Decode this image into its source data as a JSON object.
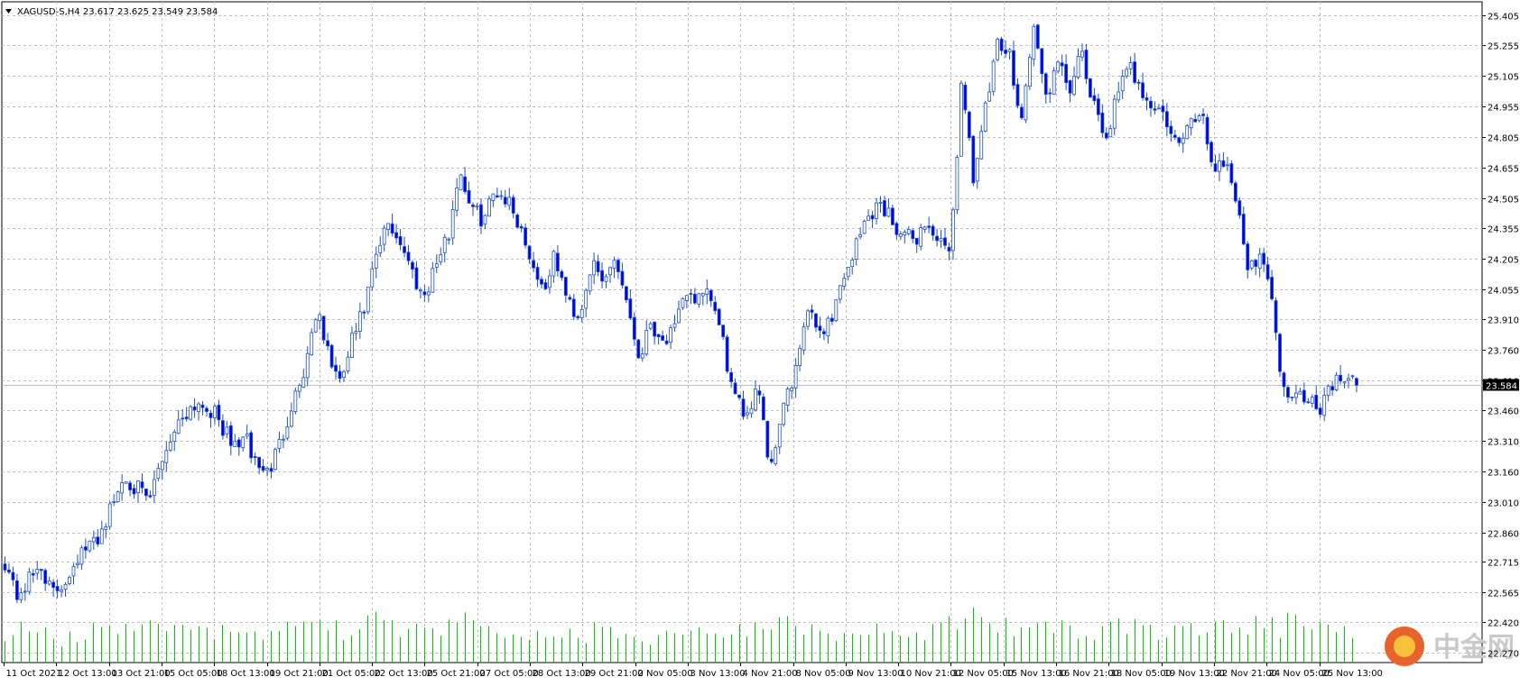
{
  "header": {
    "symbol_line": "XAGUSD-S,H4  23.617 23.625 23.549 23.584",
    "dropdown_icon": "triangle-down-icon"
  },
  "watermark": {
    "text": "中金网",
    "logo_icon": "cngold-logo-icon"
  },
  "colors": {
    "bull": "#ffffff",
    "bear": "#0000ee",
    "candle_outline": "#1e4fc8",
    "volume": "#00cc00",
    "grid": "#c0c0c0",
    "price_line": "#c0c0c0",
    "price_tag_bg": "#000000",
    "price_tag_text": "#ffffff"
  },
  "chart_data": {
    "type": "candlestick",
    "symbol": "XAGUSD-S",
    "timeframe": "H4",
    "last_price": 23.584,
    "current_price_label": "23.584",
    "ohlc_header": {
      "open": 23.617,
      "high": 23.625,
      "low": 23.549,
      "close": 23.584
    },
    "ylim": [
      22.22,
      25.47
    ],
    "y_ticks": [
      "25.405",
      "25.255",
      "25.105",
      "24.955",
      "24.805",
      "24.655",
      "24.505",
      "24.355",
      "24.205",
      "24.055",
      "23.910",
      "23.760",
      "23.610",
      "23.460",
      "23.310",
      "23.160",
      "23.010",
      "22.860",
      "22.715",
      "22.565",
      "22.420",
      "22.270"
    ],
    "x_ticks": [
      "11 Oct 2021",
      "12 Oct 13:00",
      "13 Oct 21:00",
      "15 Oct 05:00",
      "18 Oct 13:00",
      "19 Oct 21:00",
      "21 Oct 05:00",
      "22 Oct 13:00",
      "25 Oct 21:00",
      "27 Oct 05:00",
      "28 Oct 13:00",
      "29 Oct 21:00",
      "2 Nov 05:00",
      "3 Nov 13:00",
      "4 Nov 21:00",
      "8 Nov 05:00",
      "9 Nov 13:00",
      "10 Nov 21:00",
      "12 Nov 05:00",
      "15 Nov 13:00",
      "16 Nov 21:00",
      "18 Nov 05:00",
      "19 Nov 13:00",
      "22 Nov 21:00",
      "24 Nov 05:00",
      "25 Nov 13:00"
    ],
    "grid": true,
    "anchors": [
      22.72,
      22.55,
      22.62,
      22.7,
      22.55,
      22.62,
      22.74,
      22.78,
      22.86,
      23.0,
      23.14,
      23.08,
      23.0,
      23.2,
      23.35,
      23.45,
      23.5,
      23.48,
      23.4,
      23.28,
      23.33,
      23.2,
      23.15,
      23.3,
      23.5,
      23.65,
      23.95,
      23.75,
      23.58,
      23.8,
      23.95,
      24.2,
      24.38,
      24.3,
      24.15,
      24.02,
      24.18,
      24.3,
      24.65,
      24.45,
      24.4,
      24.55,
      24.5,
      24.38,
      24.2,
      24.05,
      24.22,
      24.0,
      23.92,
      24.18,
      24.08,
      24.22,
      24.0,
      23.72,
      23.9,
      23.8,
      23.85,
      24.05,
      24.0,
      24.02,
      23.8,
      23.5,
      23.45,
      23.6,
      23.15,
      23.5,
      23.6,
      23.95,
      23.85,
      23.9,
      24.1,
      24.25,
      24.4,
      24.48,
      24.42,
      24.32,
      24.3,
      24.38,
      24.3,
      24.2,
      25.1,
      24.6,
      24.95,
      25.25,
      25.2,
      24.9,
      25.35,
      25.0,
      25.15,
      25.05,
      25.2,
      24.95,
      24.8,
      25.0,
      25.15,
      25.05,
      24.95,
      24.9,
      24.75,
      24.85,
      24.95,
      24.65,
      24.7,
      24.5,
      24.12,
      24.28,
      23.95,
      23.52,
      23.58,
      23.52,
      23.48,
      23.6,
      23.6,
      23.58
    ],
    "volume_anchors": [
      0.55,
      0.8,
      0.6,
      0.7,
      0.5,
      0.75,
      0.65,
      0.85,
      0.7,
      0.6,
      0.8,
      0.75,
      0.9,
      0.7,
      0.8,
      0.65,
      0.75,
      0.6,
      0.7,
      0.55,
      0.65,
      0.7,
      0.8,
      0.75,
      0.85,
      0.9,
      1.0,
      0.8,
      0.7,
      0.75,
      0.85,
      0.95,
      0.8,
      0.7,
      0.75,
      0.65,
      0.8,
      0.85,
      0.95,
      0.8,
      0.7,
      0.75,
      0.7,
      0.65,
      0.6,
      0.7,
      0.65,
      0.7,
      0.6,
      0.75,
      0.65,
      0.7,
      0.6,
      0.55,
      0.7,
      0.65,
      0.6,
      0.75,
      0.65,
      0.6,
      0.7,
      0.85,
      0.8,
      0.75,
      0.95,
      0.85,
      0.8,
      0.85,
      0.75,
      0.7,
      0.8,
      0.75,
      0.7,
      0.8,
      0.75,
      0.65,
      0.7,
      0.75,
      0.85,
      0.9,
      1.0,
      0.9,
      0.85,
      0.95,
      0.8,
      0.85,
      0.9,
      0.8,
      0.85,
      0.75,
      0.8,
      0.7,
      0.75,
      0.85,
      0.8,
      0.75,
      0.7,
      0.75,
      0.85,
      0.8,
      0.75,
      0.8,
      0.85,
      0.9,
      0.95,
      0.85,
      0.8,
      0.9,
      0.7,
      0.75,
      0.7,
      0.8,
      0.75,
      0.7
    ]
  }
}
